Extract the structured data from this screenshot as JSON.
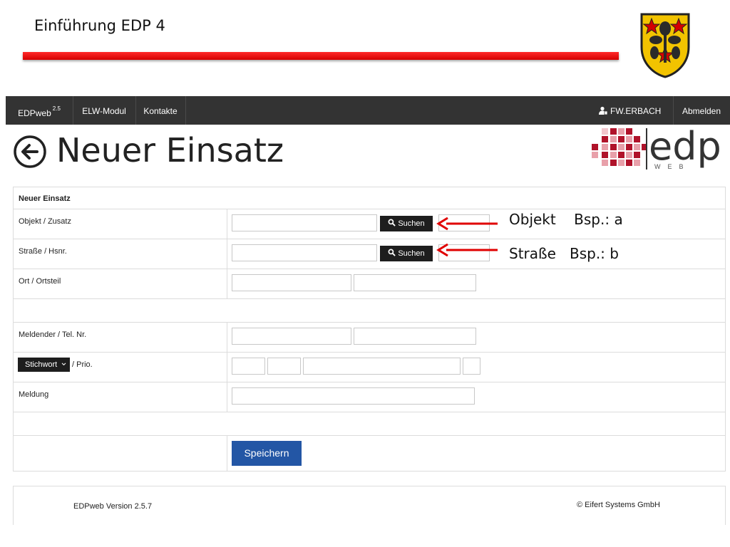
{
  "slide": {
    "title": "Einführung EDP 4"
  },
  "navbar": {
    "brand": "EDPweb",
    "brand_version": "2.5",
    "items": [
      "ELW-Modul",
      "Kontakte"
    ],
    "user": "FW.ERBACH",
    "logout": "Abmelden"
  },
  "page": {
    "title": "Neuer Einsatz"
  },
  "logo": {
    "word": "edp",
    "sub": "WEB"
  },
  "form": {
    "header": "Neuer Einsatz",
    "objekt_label": "Objekt / Zusatz",
    "strasse_label": "Straße / Hsnr.",
    "ort_label": "Ort / Ortsteil",
    "meldender_label": "Meldender / Tel. Nr.",
    "stichwort_button": "Stichwort",
    "prio_label": "/ Prio.",
    "meldung_label": "Meldung",
    "search_button": "Suchen",
    "save_button": "Speichern"
  },
  "annotations": {
    "objekt": "Objekt    Bsp.: a",
    "strasse": "Straße   Bsp.: b"
  },
  "footer": {
    "version": "EDPweb Version 2.5.7",
    "copyright": "© Eifert Systems GmbH"
  },
  "colors": {
    "accent_red": "#e00000",
    "navbar": "#333333",
    "save_button": "#2356a5",
    "logo_red": "#b0122a"
  }
}
